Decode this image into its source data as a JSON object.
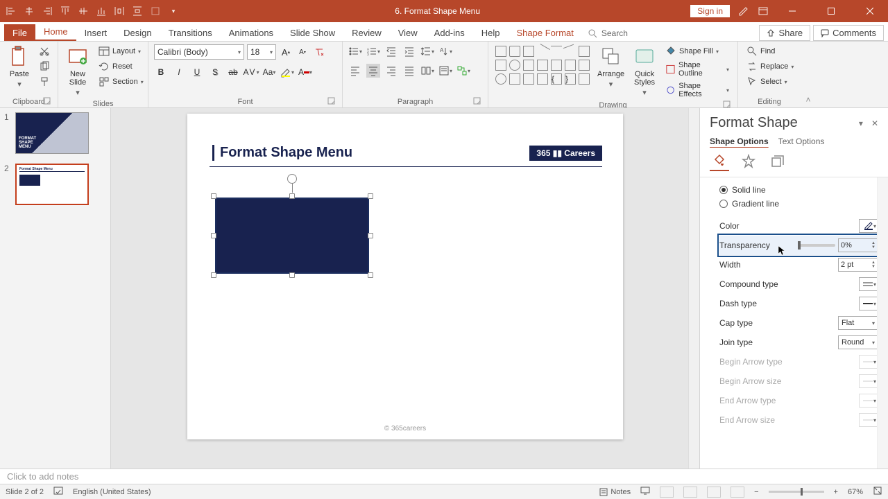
{
  "titlebar": {
    "title": "6. Format Shape Menu",
    "signin": "Sign in"
  },
  "tabs": {
    "file": "File",
    "home": "Home",
    "insert": "Insert",
    "design": "Design",
    "transitions": "Transitions",
    "animations": "Animations",
    "slideshow": "Slide Show",
    "review": "Review",
    "view": "View",
    "addins": "Add-ins",
    "help": "Help",
    "shapeformat": "Shape Format",
    "search": "Search",
    "share": "Share",
    "comments": "Comments"
  },
  "ribbon": {
    "clipboard": {
      "paste": "Paste",
      "label": "Clipboard"
    },
    "slides": {
      "newslide": "New\nSlide",
      "layout": "Layout",
      "reset": "Reset",
      "section": "Section",
      "label": "Slides"
    },
    "font": {
      "name": "Calibri (Body)",
      "size": "18",
      "label": "Font"
    },
    "paragraph": {
      "label": "Paragraph"
    },
    "drawing": {
      "arrange": "Arrange",
      "quick": "Quick\nStyles",
      "fill": "Shape Fill",
      "outline": "Shape Outline",
      "effects": "Shape Effects",
      "label": "Drawing"
    },
    "editing": {
      "find": "Find",
      "replace": "Replace",
      "select": "Select",
      "label": "Editing"
    }
  },
  "thumbs": {
    "n1": "1",
    "n2": "2",
    "t1": "FORMAT\nSHAPE\nMENU"
  },
  "slide": {
    "title": "Format Shape Menu",
    "badge": "365 ▮▮ Careers",
    "copyright": "© 365careers"
  },
  "pane": {
    "title": "Format Shape",
    "shapeopts": "Shape Options",
    "textopts": "Text Options",
    "solid": "Solid line",
    "gradient": "Gradient line",
    "color": "Color",
    "transparency": "Transparency",
    "transparency_val": "0%",
    "width": "Width",
    "width_val": "2 pt",
    "compound": "Compound type",
    "dash": "Dash type",
    "cap": "Cap type",
    "cap_val": "Flat",
    "join": "Join type",
    "join_val": "Round",
    "bat": "Begin Arrow type",
    "bas": "Begin Arrow size",
    "eat": "End Arrow type",
    "eas": "End Arrow size"
  },
  "notes": {
    "placeholder": "Click to add notes"
  },
  "status": {
    "slide": "Slide 2 of 2",
    "lang": "English (United States)",
    "notes": "Notes",
    "zoom": "67%"
  }
}
